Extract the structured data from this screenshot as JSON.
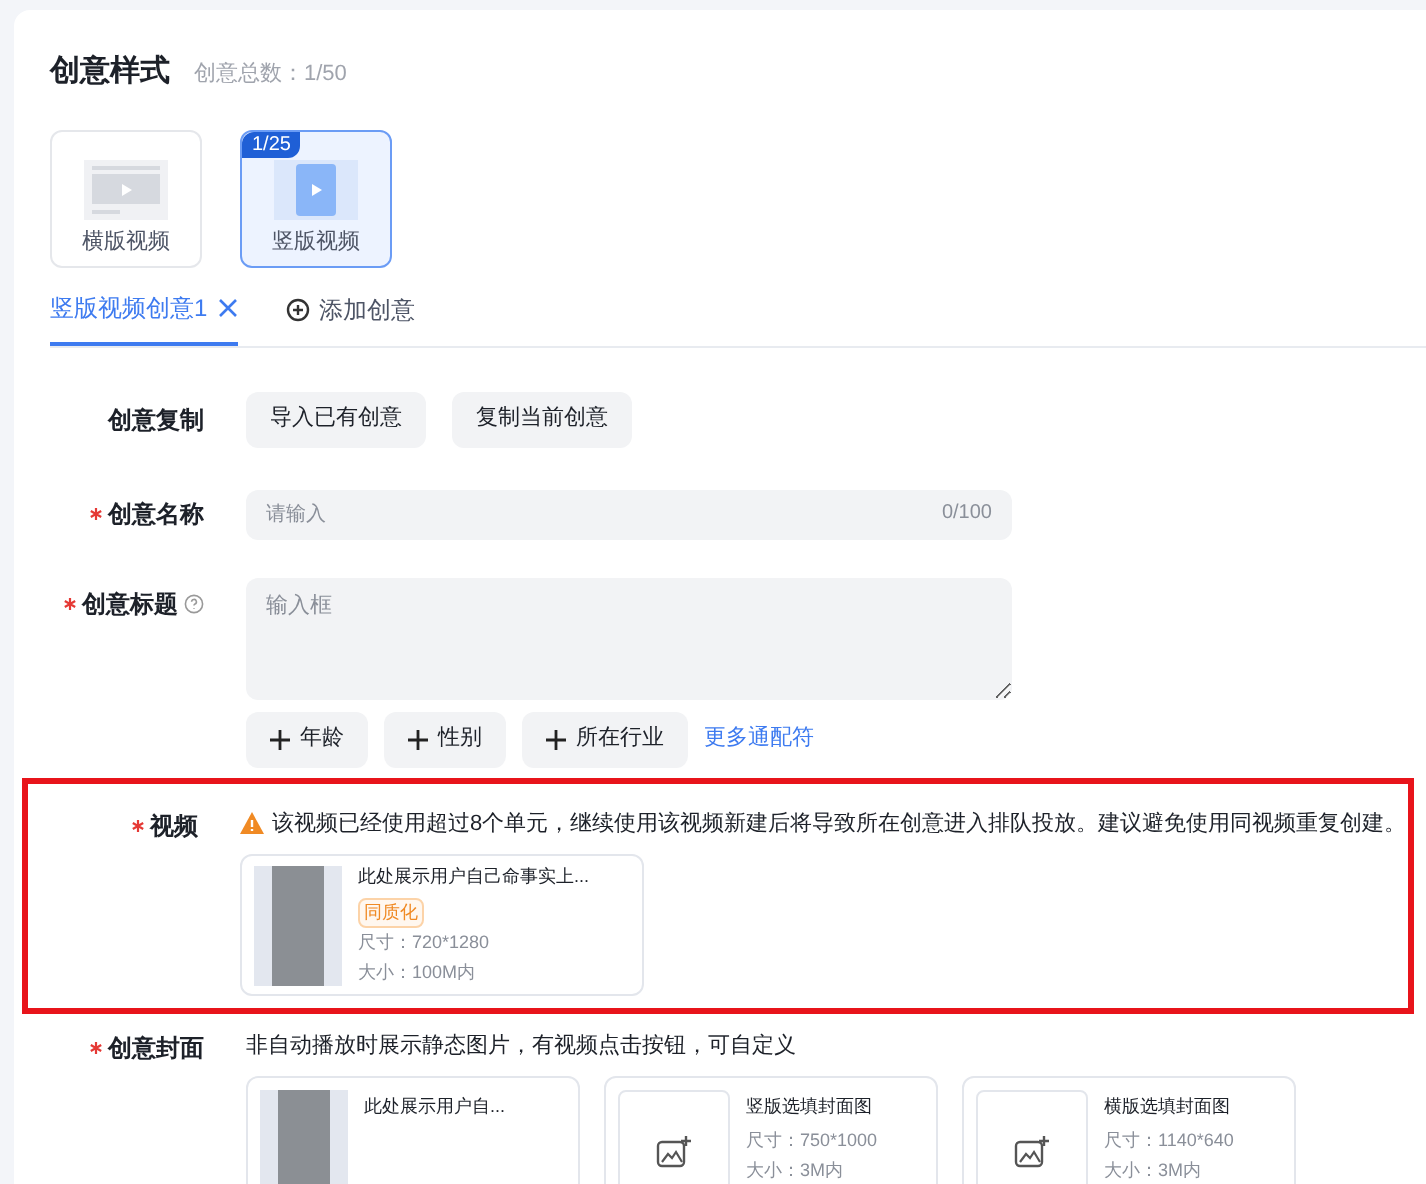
{
  "header": {
    "title": "创意样式",
    "count": "创意总数：1/50"
  },
  "styles": [
    {
      "label": "横版视频",
      "kind": "landscape",
      "selected": false
    },
    {
      "label": "竖版视频",
      "kind": "portrait",
      "selected": true,
      "badge": "1/25"
    }
  ],
  "tabs": [
    {
      "label": "竖版视频创意1",
      "kind": "creative",
      "selected": true
    },
    {
      "label": "添加创意",
      "kind": "add",
      "selected": false
    }
  ],
  "copy_row": {
    "label": "创意复制",
    "buttons": [
      "导入已有创意",
      "复制当前创意"
    ]
  },
  "name_row": {
    "required": true,
    "label": "创意名称",
    "placeholder": "请输入",
    "counter": "0/100"
  },
  "title_row": {
    "required": true,
    "label": "创意标题",
    "placeholder": "输入框",
    "tags": [
      "年龄",
      "性别",
      "所在行业"
    ],
    "link": "更多通配符"
  },
  "video_row": {
    "required": true,
    "label": "视频",
    "highlighted": true,
    "warning": "该视频已经使用超过8个单元，继续使用该视频新建后将导致所在创意进入排队投放。建议避免使用同视频重复创建。",
    "video": {
      "title": "此处展示用户自己命事实上...",
      "tag": "同质化",
      "size": "尺寸：720*1280",
      "filesize": "大小：100M内"
    }
  },
  "cover_row": {
    "required": true,
    "label": "创意封面",
    "hint": "非自动播放时展示静态图片，有视频点击按钮，可自定义",
    "covers": [
      {
        "kind": "image",
        "title": "此处展示用户自..."
      },
      {
        "kind": "upload",
        "title": "竖版选填封面图",
        "size": "尺寸：750*1000",
        "filesize": "大小：3M内"
      },
      {
        "kind": "upload",
        "title": "横版选填封面图",
        "size": "尺寸：1140*640",
        "filesize": "大小：3M内"
      }
    ]
  }
}
